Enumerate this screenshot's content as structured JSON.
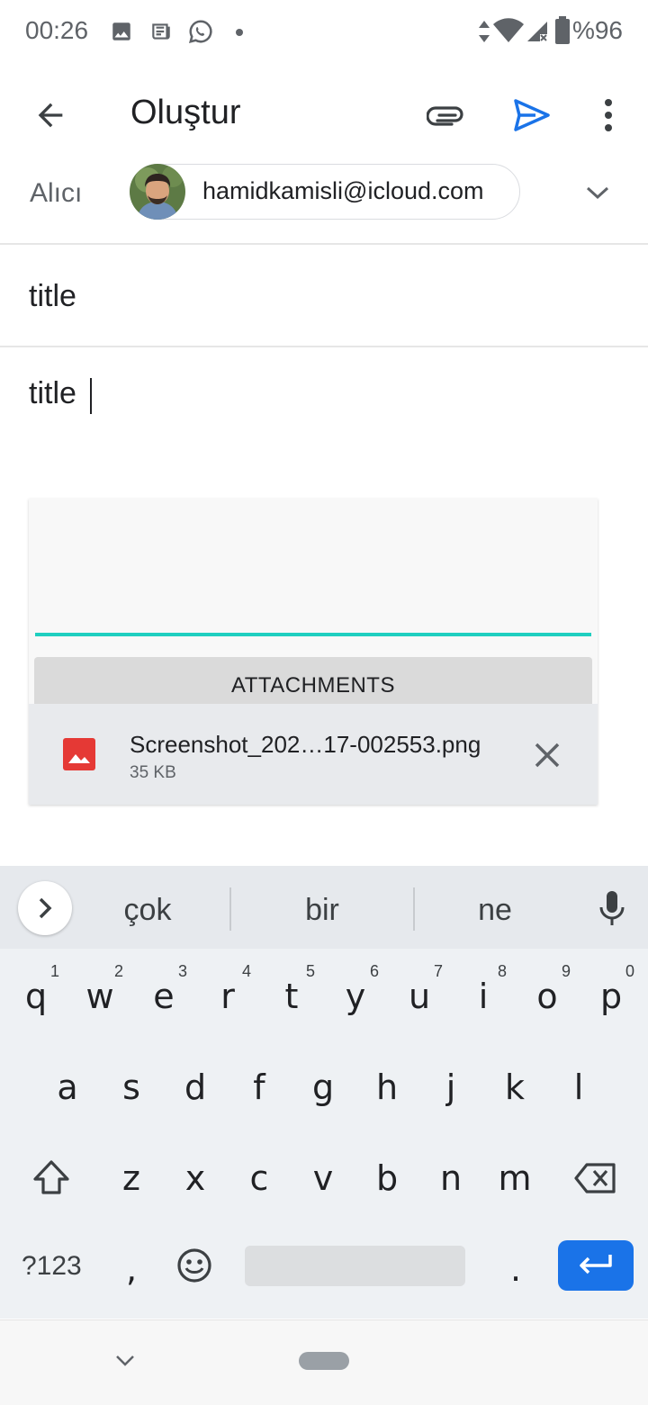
{
  "status_bar": {
    "time": "00:26",
    "battery": "%96",
    "icons": [
      "image-icon",
      "news-icon",
      "whatsapp-icon",
      "dot-icon",
      "data-arrows-icon",
      "wifi-icon",
      "signal-icon",
      "battery-icon"
    ]
  },
  "app_bar": {
    "title": "Oluştur",
    "back_icon": "arrow-left-icon",
    "attach_icon": "paperclip-icon",
    "send_icon": "send-icon",
    "more_icon": "more-vert-icon",
    "send_color": "#1a73e8"
  },
  "compose": {
    "to_label": "Alıcı",
    "recipient_email": "hamidkamisli@icloud.com",
    "subject": "title",
    "body": "title"
  },
  "attachments": {
    "header": "ATTACHMENTS",
    "accent_color": "#1fcfc0",
    "files": [
      {
        "name": "Screenshot_202…17-002553.png",
        "size": "35 KB",
        "icon": "image-file-icon",
        "icon_color": "#e53935"
      }
    ]
  },
  "keyboard": {
    "suggestions": [
      "çok",
      "bir",
      "ne"
    ],
    "row1": [
      "q",
      "w",
      "e",
      "r",
      "t",
      "y",
      "u",
      "i",
      "o",
      "p"
    ],
    "row1_numbers": [
      "1",
      "2",
      "3",
      "4",
      "5",
      "6",
      "7",
      "8",
      "9",
      "0"
    ],
    "row2": [
      "a",
      "s",
      "d",
      "f",
      "g",
      "h",
      "j",
      "k",
      "l"
    ],
    "row3": [
      "z",
      "x",
      "c",
      "v",
      "b",
      "n",
      "m"
    ],
    "symbols_label": "?123",
    "comma": ",",
    "period": ".",
    "enter_color": "#1a73e8"
  }
}
